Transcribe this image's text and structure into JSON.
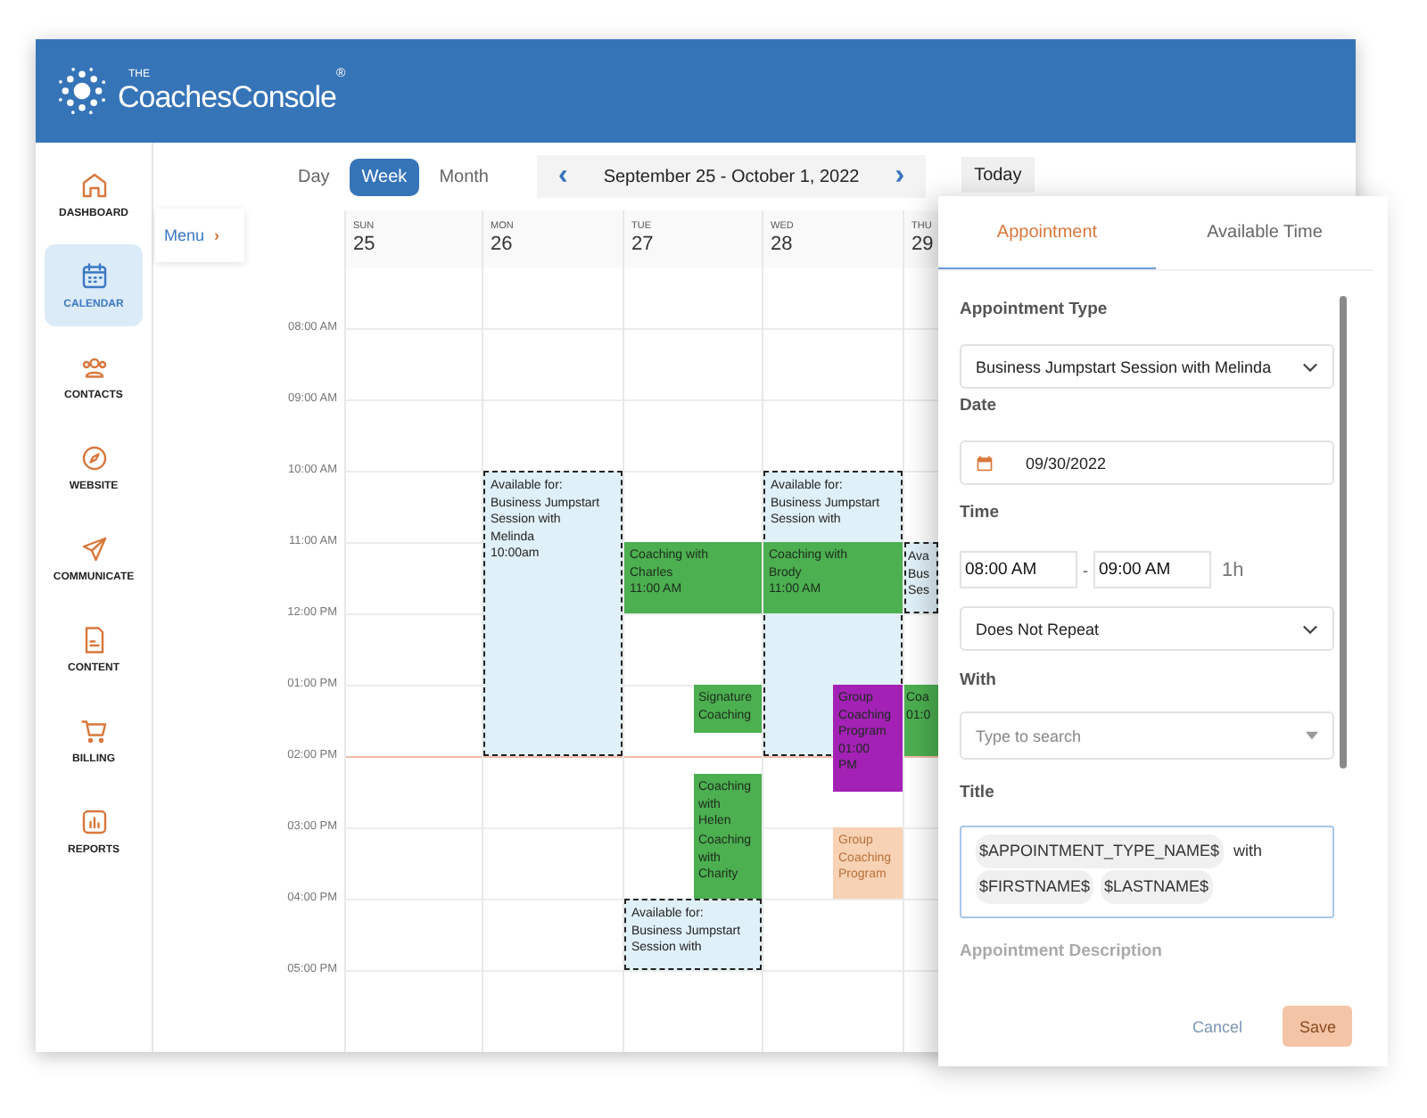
{
  "header": {
    "logo_small": "THE",
    "logo": "CoachesConsole",
    "logo_mark": "®"
  },
  "sidebar": {
    "items": [
      {
        "label": "DASHBOARD",
        "kind": "home",
        "selected": false
      },
      {
        "label": "CALENDAR",
        "kind": "calendar",
        "selected": true
      },
      {
        "label": "CONTACTS",
        "kind": "people",
        "selected": false
      },
      {
        "label": "WEBSITE",
        "kind": "compass",
        "selected": false
      },
      {
        "label": "COMMUNICATE",
        "kind": "send",
        "selected": false
      },
      {
        "label": "CONTENT",
        "kind": "document",
        "selected": false
      },
      {
        "label": "BILLING",
        "kind": "cart",
        "selected": false
      },
      {
        "label": "REPORTS",
        "kind": "chart",
        "selected": false
      }
    ]
  },
  "toolbar": {
    "views": [
      {
        "label": "Day",
        "selected": false
      },
      {
        "label": "Week",
        "selected": true
      },
      {
        "label": "Month",
        "selected": false
      }
    ],
    "prev": "‹",
    "range": "September 25 - October 1, 2022",
    "next": "›",
    "today": "Today"
  },
  "menu_button": {
    "label": "Menu",
    "arrow": "›"
  },
  "calendar": {
    "hours": [
      "08:00 AM",
      "09:00 AM",
      "10:00 AM",
      "11:00 AM",
      "12:00 PM",
      "01:00 PM",
      "02:00 PM",
      "03:00 PM",
      "04:00 PM",
      "05:00 PM"
    ],
    "days": [
      {
        "weekday": "SUN",
        "date": "25"
      },
      {
        "weekday": "MON",
        "date": "26",
        "events": [
          {
            "kind": "available",
            "text": "Available for:\nBusiness Jumpstart\nSession with\nMelinda\n10:00am"
          }
        ]
      },
      {
        "weekday": "TUE",
        "date": "27",
        "events": [
          {
            "kind": "booked",
            "color": "#4caf50",
            "text": "Coaching with\nCharles\n11:00 AM"
          },
          {
            "kind": "booked",
            "color": "#4caf50",
            "text": "Signature\nCoaching"
          },
          {
            "kind": "booked",
            "color": "#4caf50",
            "text": "Coaching\nwith\nHelen"
          },
          {
            "kind": "booked",
            "color": "#4caf50",
            "text": "Coaching\nwith\nCharity"
          },
          {
            "kind": "available",
            "text": "Available for:\nBusiness Jumpstart\nSession with"
          }
        ]
      },
      {
        "weekday": "WED",
        "date": "28",
        "events": [
          {
            "kind": "available",
            "text": "Available for:\nBusiness Jumpstart\nSession with"
          },
          {
            "kind": "booked",
            "color": "#4caf50",
            "text": "Coaching with\nBrody\n11:00 AM"
          },
          {
            "kind": "booked",
            "color": "#a321b5",
            "text": "Group\nCoaching\nProgram\n01:00\nPM"
          },
          {
            "kind": "booked",
            "color": "#f8d2b4",
            "text": "Group\nCoaching\nProgram"
          }
        ]
      },
      {
        "weekday": "THU",
        "date": "29",
        "events": [
          {
            "kind": "available",
            "text": "Ava\nBus\nSes"
          },
          {
            "kind": "booked",
            "color": "#4caf50",
            "text": "Coa\n01:0"
          }
        ]
      }
    ]
  },
  "panel": {
    "tabs": [
      {
        "label": "Appointment",
        "selected": true
      },
      {
        "label": "Available Time",
        "selected": false
      }
    ],
    "appointment_type": {
      "label": "Appointment Type",
      "value": "Business Jumpstart Session with Melinda"
    },
    "date": {
      "label": "Date",
      "value": "09/30/2022"
    },
    "time": {
      "label": "Time",
      "start": "08:00 AM",
      "separator": "-",
      "end": "09:00 AM",
      "duration": "1h"
    },
    "repeat": {
      "value": "Does Not Repeat"
    },
    "with": {
      "label": "With",
      "placeholder": "Type to search"
    },
    "title": {
      "label": "Title",
      "parts": [
        {
          "kind": "token",
          "text": "$APPOINTMENT_TYPE_NAME$"
        },
        {
          "kind": "word",
          "text": "with"
        },
        {
          "kind": "token",
          "text": "$FIRSTNAME$"
        },
        {
          "kind": "token",
          "text": "$LASTNAME$"
        }
      ]
    },
    "description": {
      "label": "Appointment Description"
    },
    "buttons": [
      {
        "label": "Cancel",
        "kind": "cancel",
        "disabled": true
      },
      {
        "label": "Save",
        "kind": "save",
        "disabled": true
      }
    ]
  }
}
